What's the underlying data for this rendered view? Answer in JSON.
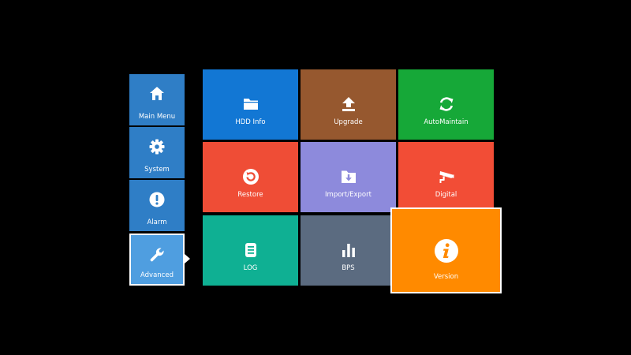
{
  "sidebar": {
    "items": [
      {
        "label": "Main Menu",
        "icon": "home-icon",
        "color": "#2f7ec6"
      },
      {
        "label": "System",
        "icon": "gear-icon",
        "color": "#2f7ec6"
      },
      {
        "label": "Alarm",
        "icon": "alert-icon",
        "color": "#2f7ec6"
      },
      {
        "label": "Advanced",
        "icon": "wrench-icon",
        "color": "#4f9ee0",
        "selected": true
      }
    ]
  },
  "tiles": [
    {
      "label": "HDD Info",
      "icon": "folder-icon",
      "color": "#1277d4"
    },
    {
      "label": "Upgrade",
      "icon": "upload-arrow-icon",
      "color": "#96582f"
    },
    {
      "label": "AutoMaintain",
      "icon": "refresh-icon",
      "color": "#16a838"
    },
    {
      "label": "Restore",
      "icon": "restore-icon",
      "color": "#ef4d36"
    },
    {
      "label": "Import/Export",
      "icon": "folder-download-icon",
      "color": "#8d8adc"
    },
    {
      "label": "Digital",
      "icon": "camera-icon",
      "color": "#f24d36"
    },
    {
      "label": "LOG",
      "icon": "log-icon",
      "color": "#0fb093"
    },
    {
      "label": "BPS",
      "icon": "bar-chart-icon",
      "color": "#5b6b80"
    },
    {
      "label": "Version",
      "icon": "info-icon",
      "color": "#ff8a00",
      "selected": true
    }
  ]
}
